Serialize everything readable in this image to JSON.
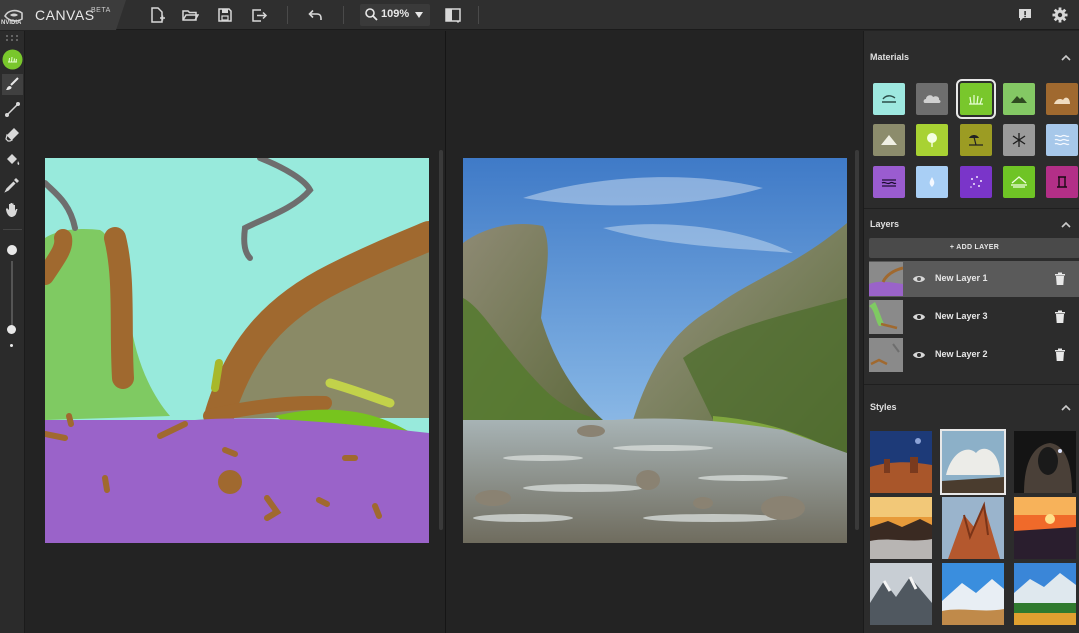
{
  "app": {
    "logo_text": "NVIDIA",
    "name": "CANVAS",
    "tag": "BETA"
  },
  "toolbar": {
    "zoom": "109%",
    "icons": [
      "new-file-icon",
      "open-folder-icon",
      "save-icon",
      "export-icon",
      "undo-icon",
      "zoom-icon",
      "split-view-icon",
      "feedback-icon",
      "settings-icon"
    ]
  },
  "tools": [
    "material-swatch",
    "brush-icon",
    "line-icon",
    "eraser-icon",
    "fill-bucket-icon",
    "eyedropper-icon",
    "pan-hand-icon"
  ],
  "materials": {
    "title": "Materials",
    "items": [
      {
        "name": "sky",
        "color": "#9ee8e0"
      },
      {
        "name": "cloud",
        "color": "#6e6e6e"
      },
      {
        "name": "grass",
        "color": "#79c72c",
        "selected": true
      },
      {
        "name": "hill",
        "color": "#84c864"
      },
      {
        "name": "dirt",
        "color": "#a0692f"
      },
      {
        "name": "mountain",
        "color": "#8c8c6c"
      },
      {
        "name": "tree",
        "color": "#a8d233"
      },
      {
        "name": "sand",
        "color": "#9c9c23"
      },
      {
        "name": "snow",
        "color": "#9a9a9a"
      },
      {
        "name": "sea",
        "color": "#a7c8ea"
      },
      {
        "name": "river",
        "color": "#9a5cd0"
      },
      {
        "name": "water",
        "color": "#a9cff5"
      },
      {
        "name": "fog",
        "color": "#7a35c9"
      },
      {
        "name": "mountain-fog",
        "color": "#6fc425"
      },
      {
        "name": "stone",
        "color": "#b32f87"
      }
    ]
  },
  "layers": {
    "title": "Layers",
    "add_label": "+ ADD LAYER",
    "items": [
      {
        "name": "New Layer 1",
        "active": true
      },
      {
        "name": "New Layer 3",
        "active": false
      },
      {
        "name": "New Layer 2",
        "active": false
      }
    ]
  },
  "styles": {
    "title": "Styles",
    "count": 9,
    "selected_index": 1
  }
}
